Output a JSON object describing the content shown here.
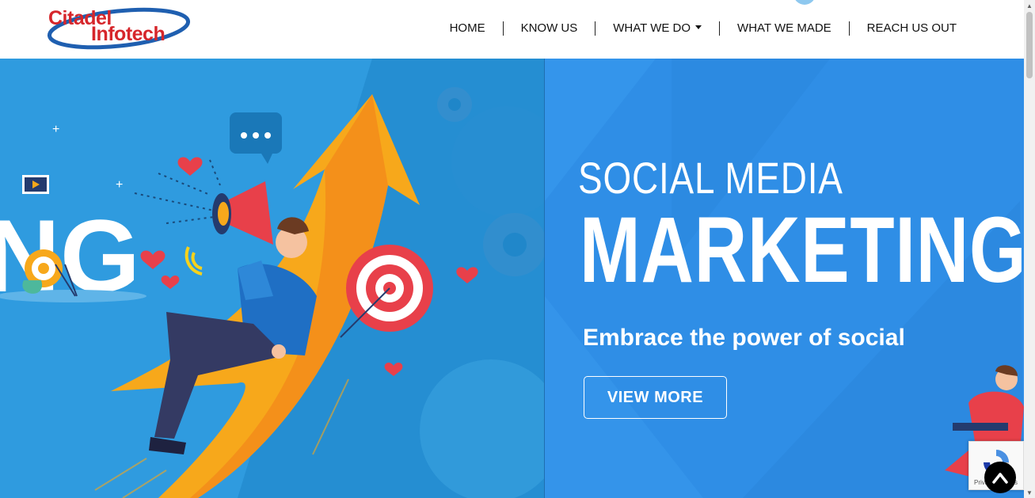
{
  "brand": {
    "logo_line1": "Citadel",
    "logo_line2": "Infotech",
    "logo_color": "#d6262b",
    "ring_color": "#1f5fb0"
  },
  "nav": {
    "items": [
      {
        "label": "HOME"
      },
      {
        "label": "KNOW US"
      },
      {
        "label": "WHAT WE DO",
        "has_dropdown": true
      },
      {
        "label": "WHAT WE MADE"
      },
      {
        "label": "REACH US OUT"
      }
    ]
  },
  "hero": {
    "left_partial_text": "NG",
    "heading_line1": "SOCIAL MEDIA",
    "heading_line2": "MARKETING",
    "tagline": "Embrace the power of social",
    "cta_label": "VIEW MORE",
    "bg_left": "#2f9bdf",
    "bg_right": "#2f8ee6",
    "accent_orange": "#f7a81b",
    "accent_red": "#e8404a"
  },
  "widgets": {
    "recaptcha_text": "Privacy - Terms",
    "back_to_top_icon": "chevron-up-icon"
  }
}
